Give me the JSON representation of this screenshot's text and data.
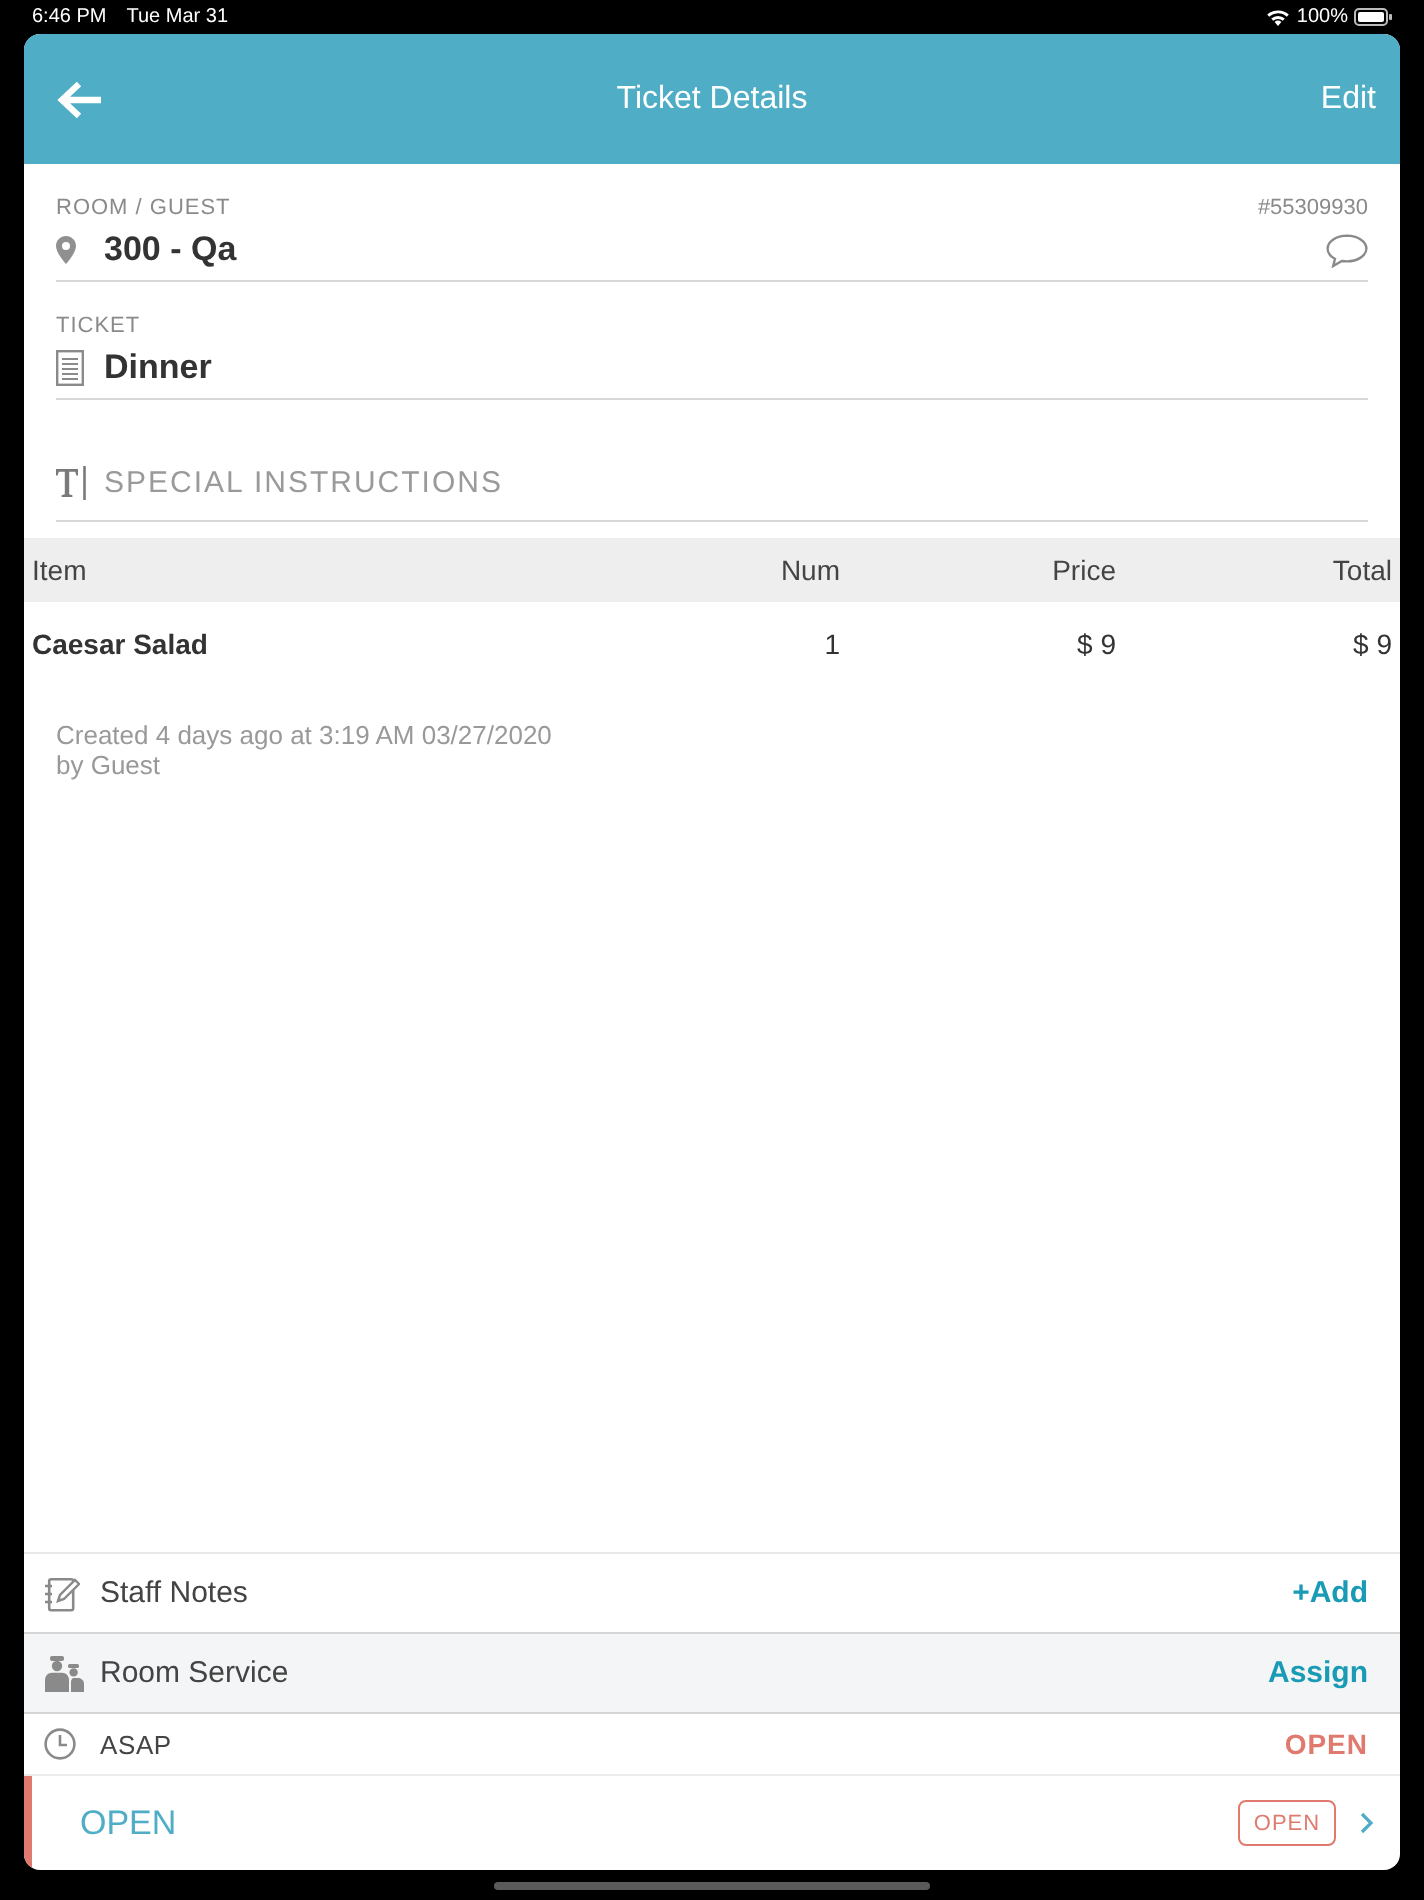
{
  "status_bar": {
    "time": "6:46 PM",
    "date": "Tue Mar 31",
    "battery": "100%"
  },
  "header": {
    "title": "Ticket Details",
    "action": "Edit"
  },
  "fields": [
    {
      "kind": "location",
      "label": "ROOM / GUEST",
      "value": "300 - Qa",
      "number": "#55309930"
    },
    {
      "kind": "ticket",
      "label": "TICKET",
      "value": "Dinner"
    }
  ],
  "special_instructions": {
    "placeholder": "SPECIAL INSTRUCTIONS"
  },
  "table": {
    "columns": [
      "Item",
      "Num",
      "Price",
      "Total"
    ],
    "rows": [
      [
        "Caesar Salad",
        "1",
        "$ 9",
        "$ 9"
      ]
    ]
  },
  "created": [
    "Created 4 days ago at 3:19 AM 03/27/2020",
    "by Guest"
  ],
  "sections": [
    {
      "kind": "notes",
      "label": "Staff Notes",
      "action": "+Add"
    },
    {
      "kind": "staff",
      "label": "Room Service",
      "action": "Assign"
    }
  ],
  "schedule": {
    "label": "ASAP",
    "status": "OPEN"
  },
  "status_row": {
    "status": "OPEN",
    "badge": "OPEN"
  }
}
